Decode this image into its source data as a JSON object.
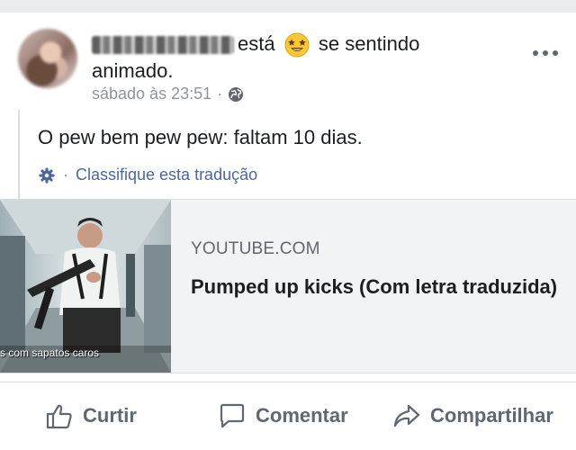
{
  "post": {
    "status_verb": "está",
    "feeling_text": "se sentindo",
    "feeling_word": "animado.",
    "timestamp": "sábado às 23:51",
    "separator": "·",
    "body": "O pew bem pew pew: faltam 10 dias.",
    "translate_sep": "·",
    "translate_label": "Classifique esta tradução",
    "feeling_icon": "star-struck-emoji",
    "privacy_icon": "globe-icon"
  },
  "link": {
    "domain": "YOUTUBE.COM",
    "title": "Pumped up kicks (Com letra traduzida)",
    "thumb_caption": "s com sapatos caros"
  },
  "actions": {
    "like": "Curtir",
    "comment": "Comentar",
    "share": "Compartilhar"
  },
  "colors": {
    "link_blue": "#4b67a1",
    "muted": "#90949c",
    "action_gray": "#606770"
  }
}
